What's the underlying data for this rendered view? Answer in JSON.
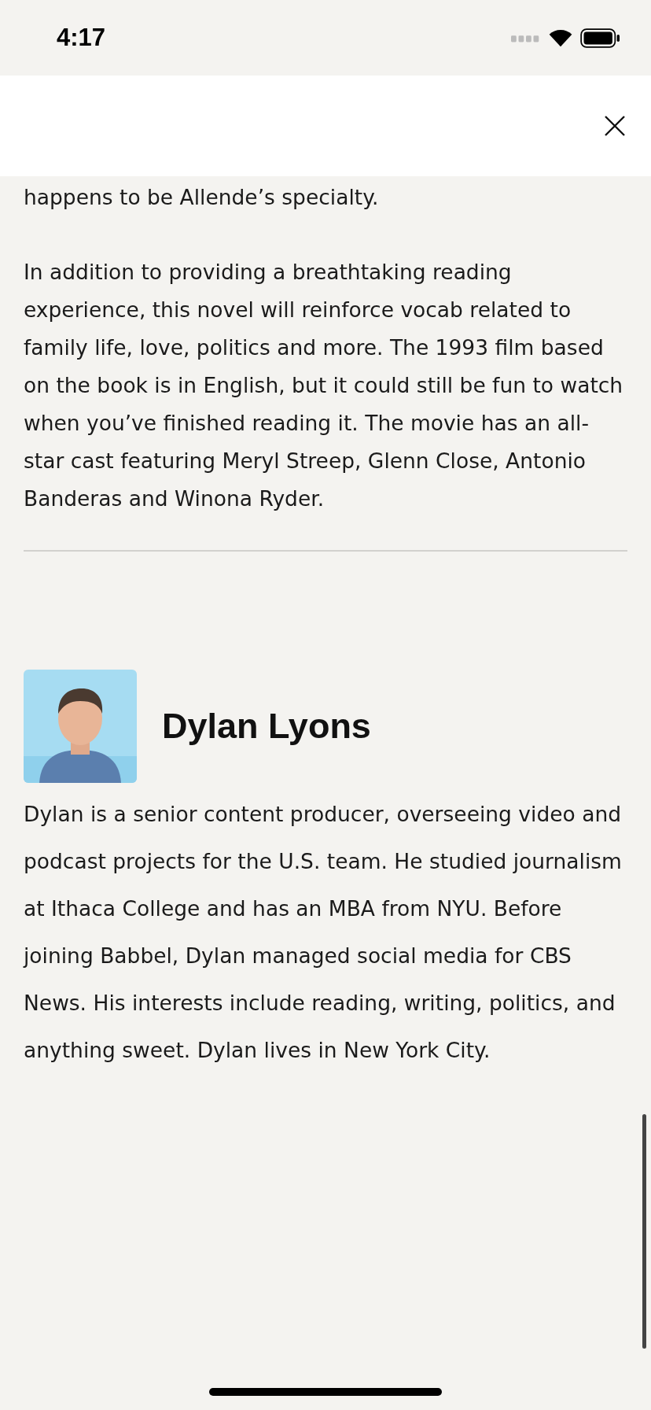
{
  "status_bar": {
    "time": "4:17"
  },
  "article": {
    "paragraphs": [
      "happens to be Allende’s specialty.",
      "In addition to providing a breathtaking reading experience, this novel will reinforce vocab related to family life, love, politics and more. The 1993 film based on the book is in English, but it could still be fun to watch when you’ve finished reading it. The movie has an all-star cast featuring Meryl Streep, Glenn Close, Antonio Banderas and Winona Ryder."
    ]
  },
  "author": {
    "name": "Dylan Lyons",
    "bio": "Dylan is a senior content producer, overseeing video and podcast projects for the U.S. team. He studied journalism at Ithaca College and has an MBA from NYU. Before joining Babbel, Dylan managed social media for CBS News. His interests include reading, writing, politics, and anything sweet. Dylan lives in New York City."
  }
}
